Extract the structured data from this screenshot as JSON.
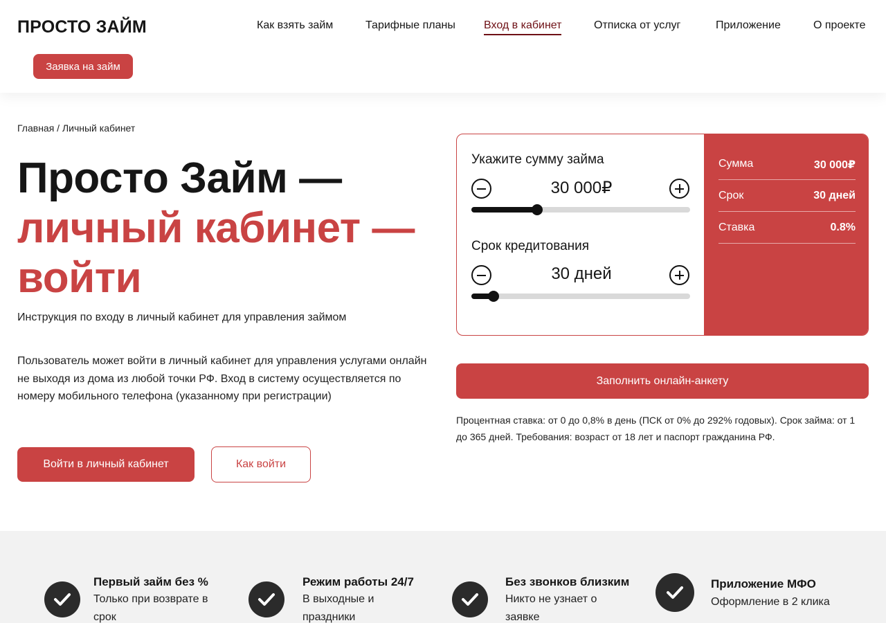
{
  "header": {
    "logo": "ПРОСТО ЗАЙМ",
    "nav": [
      {
        "label": "Как взять займ"
      },
      {
        "label": "Тарифные планы"
      },
      {
        "label": "Вход в кабинет"
      },
      {
        "label": "Отписка от услуг"
      },
      {
        "label": "Приложение"
      },
      {
        "label": "О проекте"
      }
    ],
    "apply_button": "Заявка на займ"
  },
  "breadcrumb": "Главная / Личный кабинет",
  "hero": {
    "title_line1": "Просто Займ —",
    "title_line2": "личный кабинет —",
    "title_line3": "войти",
    "subtitle": "Инструкция по входу в личный кабинет для управления займом",
    "description": "Пользователь может войти в личный кабинет для управления услугами онлайн не выходя из дома из любой точки РФ. Вход в систему осуществляется по номеру мобильного телефона (указанному при регистрации)",
    "login_button": "Войти в личный кабинет",
    "how_button": "Как войти"
  },
  "calculator": {
    "amount_label": "Укажите сумму займа",
    "amount_value": "30 000₽",
    "amount_slider_fraction": 0.3,
    "term_label": "Срок кредитования",
    "term_value": "30 дней",
    "term_slider_fraction": 0.1,
    "summary": [
      {
        "key": "Сумма",
        "value": "30 000₽"
      },
      {
        "key": "Срок",
        "value": "30 дней"
      },
      {
        "key": "Ставка",
        "value": "0.8%"
      }
    ],
    "accent_color": "#c94343"
  },
  "fill_button": "Заполнить онлайн-анкету",
  "terms": "Процентная ставка: от 0 до 0,8% в день (ПСК от 0% до 292% годовых). Срок займа: от 1 до 365 дней. Требования: возраст от 18 лет и паспорт гражданина РФ.",
  "features": [
    {
      "title": "Первый займ без %",
      "text": "Только при возврате в срок",
      "icon": "check-icon"
    },
    {
      "title": "Режим работы 24/7",
      "text": "В выходные и праздники",
      "icon": "check-icon"
    },
    {
      "title": "Без звонков близким",
      "text": "Никто не узнает о заявке",
      "icon": "check-icon"
    },
    {
      "title": "Приложение МФО",
      "text": "Оформление в 2 клика",
      "icon": "check-icon"
    }
  ]
}
